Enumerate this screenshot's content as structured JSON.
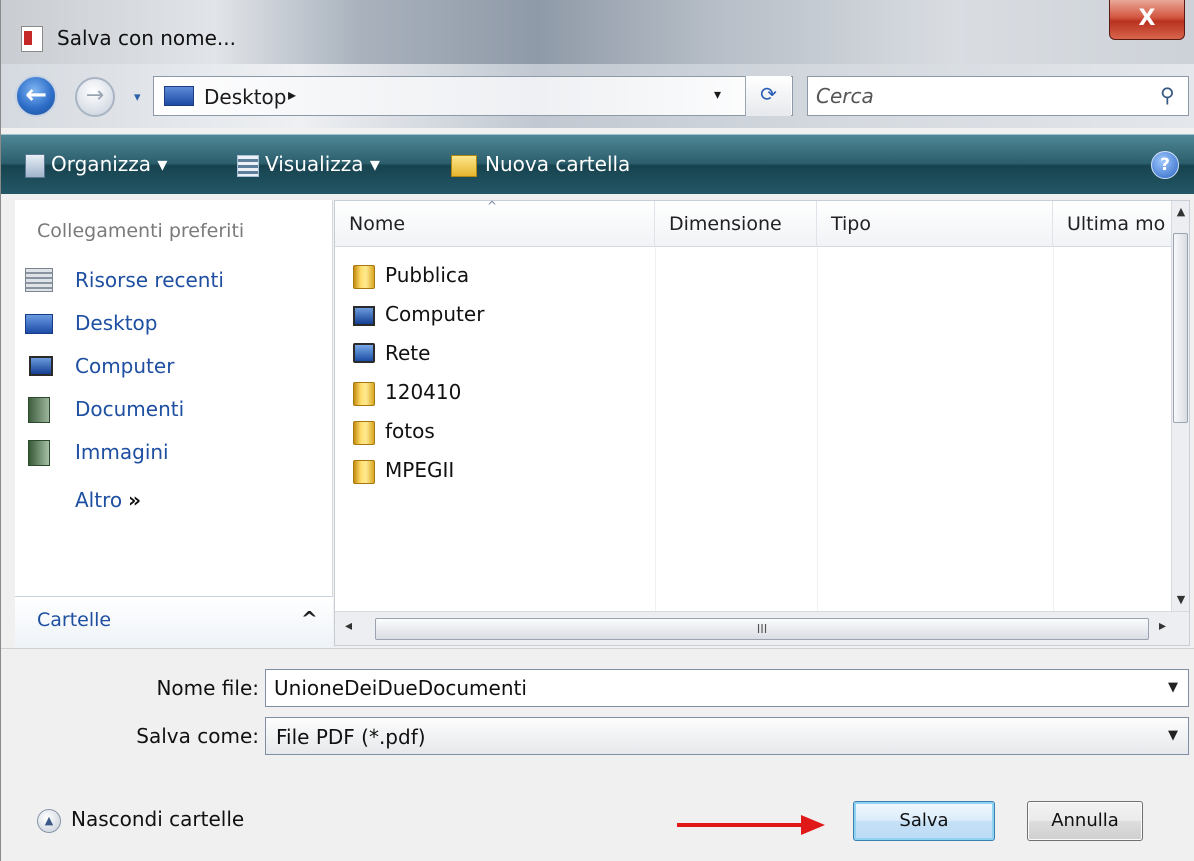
{
  "window": {
    "title": "Salva con nome...",
    "close_glyph": "X"
  },
  "navigation": {
    "back_glyph": "←",
    "forward_glyph": "→",
    "address": {
      "location": "Desktop",
      "separator": "▸",
      "dropdown_glyph": "▾"
    },
    "refresh_glyph": "⟳",
    "search": {
      "placeholder": "Cerca",
      "icon": "search-icon"
    }
  },
  "toolbar": {
    "organize_label": "Organizza ▾",
    "views_label": "Visualizza ▾",
    "new_folder_label": "Nuova cartella",
    "help_glyph": "?"
  },
  "sidebar": {
    "favorites_header": "Collegamenti preferiti",
    "items": [
      {
        "label": "Risorse recenti",
        "icon": "recent-places-icon"
      },
      {
        "label": "Desktop",
        "icon": "desktop-icon"
      },
      {
        "label": "Computer",
        "icon": "computer-icon"
      },
      {
        "label": "Documenti",
        "icon": "documents-icon"
      },
      {
        "label": "Immagini",
        "icon": "pictures-icon"
      }
    ],
    "more_label": "Altro",
    "more_glyph": "»",
    "folders_label": "Cartelle",
    "folders_chevron": "^"
  },
  "file_list": {
    "columns": [
      "Nome",
      "Dimensione",
      "Tipo",
      "Ultima mo"
    ],
    "sort_glyph": "^",
    "rows": [
      {
        "name": "Pubblica",
        "icon": "folder-icon"
      },
      {
        "name": "Computer",
        "icon": "computer-icon"
      },
      {
        "name": "Rete",
        "icon": "network-icon"
      },
      {
        "name": "120410",
        "icon": "folder-icon"
      },
      {
        "name": "fotos",
        "icon": "folder-icon"
      },
      {
        "name": "MPEGII",
        "icon": "folder-icon"
      }
    ],
    "scroll_grip": "III"
  },
  "form": {
    "filename_label": "Nome file:",
    "filename_value": "UnioneDeiDueDocumenti",
    "savetype_label": "Salva come:",
    "savetype_value": "File PDF (*.pdf)",
    "hide_folders_label": "Nascondi cartelle",
    "save_label": "Salva",
    "cancel_label": "Annulla"
  },
  "colors": {
    "toolbar": "#2c5e6c",
    "link": "#1e4fa1",
    "annotation_arrow": "#e01818",
    "close_button": "#c8412b"
  }
}
